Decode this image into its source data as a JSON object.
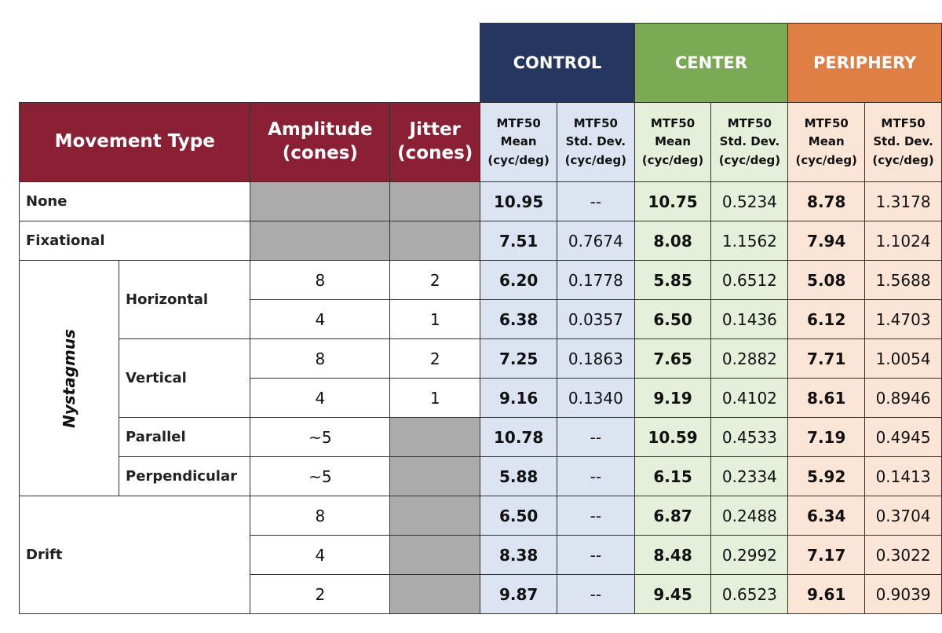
{
  "groups": {
    "control": "CONTROL",
    "center": "CENTER",
    "periphery": "PERIPHERY"
  },
  "colors": {
    "header_maroon": "#8B2035",
    "control": "#253760",
    "center": "#7BAA55",
    "periphery": "#E07F43",
    "control_light": "#DCE4F2",
    "center_light": "#E5EFDA",
    "periphery_light": "#FBE5D6",
    "empty_gray": "#ABABAB"
  },
  "headers": {
    "movement_type": "Movement Type",
    "amplitude": [
      "Amplitude",
      "(cones)"
    ],
    "jitter": [
      "Jitter",
      "(cones)"
    ],
    "mean": [
      "MTF50",
      "Mean",
      "(cyc/deg)"
    ],
    "std": [
      "MTF50",
      "Std. Dev.",
      "(cyc/deg)"
    ]
  },
  "labels": {
    "none": "None",
    "fixational": "Fixational",
    "nystagmus": "Nystagmus",
    "horizontal": "Horizontal",
    "vertical": "Vertical",
    "parallel": "Parallel",
    "perpendicular": "Perpendicular",
    "drift": "Drift"
  },
  "rows": [
    {
      "amp": "",
      "jit": "",
      "vals": [
        "10.95",
        "--",
        "10.75",
        "0.5234",
        "8.78",
        "1.3178"
      ]
    },
    {
      "amp": "",
      "jit": "",
      "vals": [
        "7.51",
        "0.7674",
        "8.08",
        "1.1562",
        "7.94",
        "1.1024"
      ]
    },
    {
      "amp": "8",
      "jit": "2",
      "vals": [
        "6.20",
        "0.1778",
        "5.85",
        "0.6512",
        "5.08",
        "1.5688"
      ]
    },
    {
      "amp": "4",
      "jit": "1",
      "vals": [
        "6.38",
        "0.0357",
        "6.50",
        "0.1436",
        "6.12",
        "1.4703"
      ]
    },
    {
      "amp": "8",
      "jit": "2",
      "vals": [
        "7.25",
        "0.1863",
        "7.65",
        "0.2882",
        "7.71",
        "1.0054"
      ]
    },
    {
      "amp": "4",
      "jit": "1",
      "vals": [
        "9.16",
        "0.1340",
        "9.19",
        "0.4102",
        "8.61",
        "0.8946"
      ]
    },
    {
      "amp": "~5",
      "jit": "",
      "vals": [
        "10.78",
        "--",
        "10.59",
        "0.4533",
        "7.19",
        "0.4945"
      ]
    },
    {
      "amp": "~5",
      "jit": "",
      "vals": [
        "5.88",
        "--",
        "6.15",
        "0.2334",
        "5.92",
        "0.1413"
      ]
    },
    {
      "amp": "8",
      "jit": "",
      "vals": [
        "6.50",
        "--",
        "6.87",
        "0.2488",
        "6.34",
        "0.3704"
      ]
    },
    {
      "amp": "4",
      "jit": "",
      "vals": [
        "8.38",
        "--",
        "8.48",
        "0.2992",
        "7.17",
        "0.3022"
      ]
    },
    {
      "amp": "2",
      "jit": "",
      "vals": [
        "9.87",
        "--",
        "9.45",
        "0.6523",
        "9.61",
        "0.9039"
      ]
    }
  ]
}
